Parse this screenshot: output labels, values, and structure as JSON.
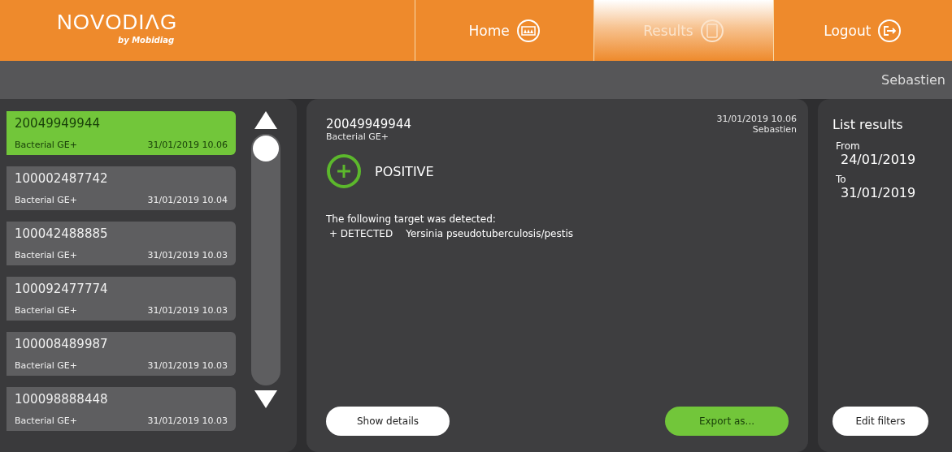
{
  "header": {
    "logo": "NOVODIΛG",
    "logo_sub": "by Mobidiag"
  },
  "nav": [
    {
      "label": "Home",
      "kind": "home",
      "selected": false
    },
    {
      "label": "Results",
      "kind": "results",
      "selected": true
    },
    {
      "label": "Logout",
      "kind": "logout",
      "selected": false
    }
  ],
  "user": "Sebastien",
  "results": [
    {
      "id": "20049949944",
      "test": "Bacterial GE+",
      "time": "31/01/2019 10.06",
      "selected": true
    },
    {
      "id": "100002487742",
      "test": "Bacterial GE+",
      "time": "31/01/2019 10.04",
      "selected": false
    },
    {
      "id": "100042488885",
      "test": "Bacterial GE+",
      "time": "31/01/2019 10.03",
      "selected": false
    },
    {
      "id": "100092477774",
      "test": "Bacterial GE+",
      "time": "31/01/2019 10.03",
      "selected": false
    },
    {
      "id": "100008489987",
      "test": "Bacterial GE+",
      "time": "31/01/2019 10.03",
      "selected": false
    },
    {
      "id": "100098888448",
      "test": "Bacterial GE+",
      "time": "31/01/2019 10.03",
      "selected": false
    }
  ],
  "detail": {
    "id": "20049949944",
    "test": "Bacterial GE+",
    "time": "31/01/2019 10.06",
    "operator": "Sebastien",
    "kind": "positive",
    "status_label": "POSITIVE",
    "message": "The following target was detected:",
    "targets": [
      {
        "result": "+ DETECTED",
        "name": "Yersinia pseudotuberculosis/pestis"
      }
    ],
    "buttons": [
      "Show details",
      "Export as..."
    ]
  },
  "filters": {
    "title": "List results",
    "from_label": "From",
    "from": "24/01/2019",
    "to_label": "To",
    "to": "31/01/2019",
    "button": "Edit filters"
  }
}
